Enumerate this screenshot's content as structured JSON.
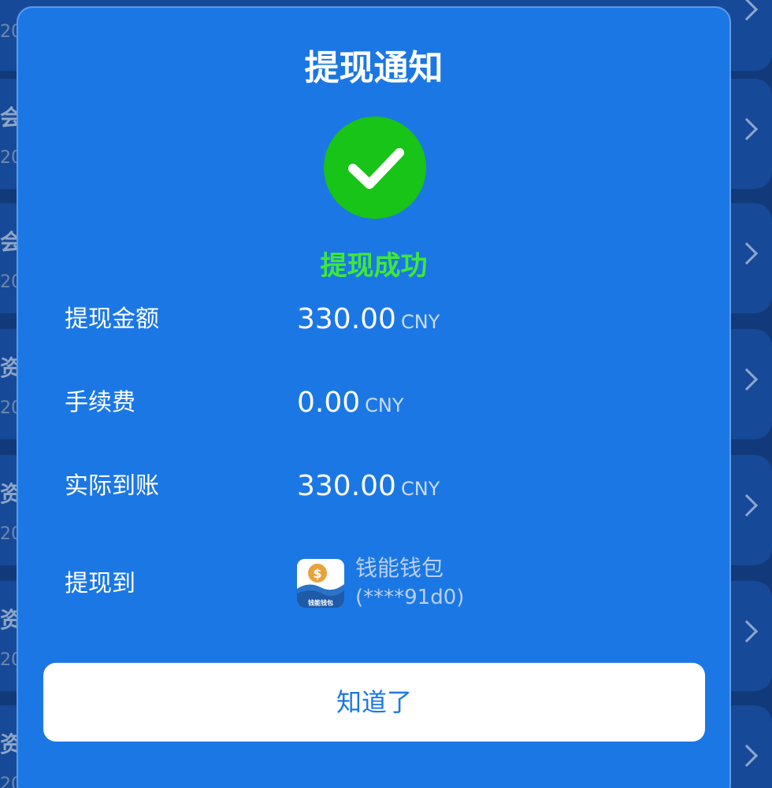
{
  "modal": {
    "title": "提现通知",
    "status": "提现成功",
    "rows": [
      {
        "label": "提现金额",
        "amount": "330.00",
        "unit": "CNY"
      },
      {
        "label": "手续费",
        "amount": "0.00",
        "unit": "CNY"
      },
      {
        "label": "实际到账",
        "amount": "330.00",
        "unit": "CNY"
      }
    ],
    "destination": {
      "label": "提现到",
      "wallet_name": "钱能钱包",
      "account": "(****91d0)",
      "logo_text": "钱能钱包"
    },
    "ok_button": "知道了"
  },
  "background": {
    "rows": [
      {
        "title": "会",
        "sub": "20"
      },
      {
        "title": "会",
        "sub": "20"
      },
      {
        "title": "资",
        "sub": "20"
      },
      {
        "title": "资",
        "sub": "20"
      },
      {
        "title": "资",
        "sub": "20"
      },
      {
        "title": "资",
        "sub": "20"
      }
    ],
    "first_sub": "20"
  },
  "colors": {
    "modal_bg": "#1b77e4",
    "success_green": "#17c417",
    "status_green": "#3ee83a",
    "button_bg": "#ffffff",
    "button_text": "#1b77e4"
  },
  "icons": {
    "success": "checkmark-circle-icon",
    "chevron": "chevron-right-icon",
    "wallet": "wallet-logo-icon"
  }
}
